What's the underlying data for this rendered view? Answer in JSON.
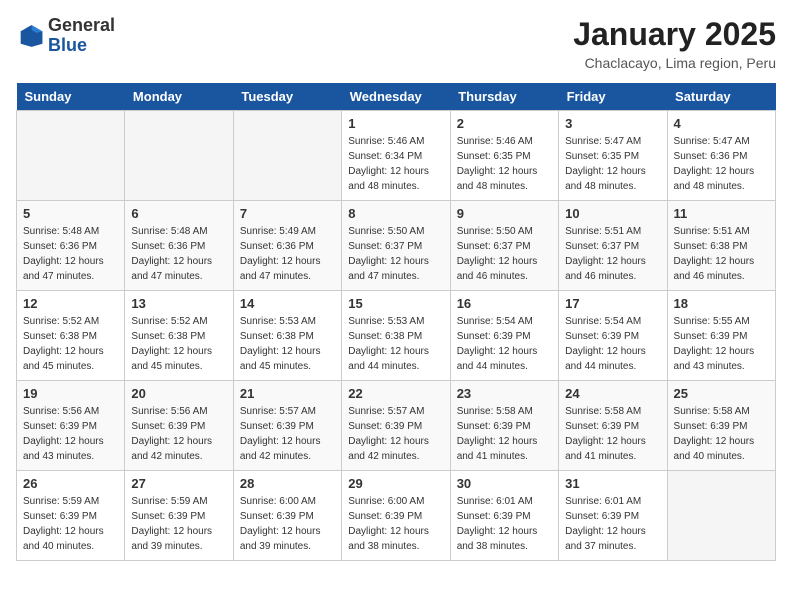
{
  "header": {
    "logo_general": "General",
    "logo_blue": "Blue",
    "title": "January 2025",
    "subtitle": "Chaclacayo, Lima region, Peru"
  },
  "weekdays": [
    "Sunday",
    "Monday",
    "Tuesday",
    "Wednesday",
    "Thursday",
    "Friday",
    "Saturday"
  ],
  "weeks": [
    [
      {
        "day": "",
        "sunrise": "",
        "sunset": "",
        "daylight": ""
      },
      {
        "day": "",
        "sunrise": "",
        "sunset": "",
        "daylight": ""
      },
      {
        "day": "",
        "sunrise": "",
        "sunset": "",
        "daylight": ""
      },
      {
        "day": "1",
        "sunrise": "Sunrise: 5:46 AM",
        "sunset": "Sunset: 6:34 PM",
        "daylight": "Daylight: 12 hours and 48 minutes."
      },
      {
        "day": "2",
        "sunrise": "Sunrise: 5:46 AM",
        "sunset": "Sunset: 6:35 PM",
        "daylight": "Daylight: 12 hours and 48 minutes."
      },
      {
        "day": "3",
        "sunrise": "Sunrise: 5:47 AM",
        "sunset": "Sunset: 6:35 PM",
        "daylight": "Daylight: 12 hours and 48 minutes."
      },
      {
        "day": "4",
        "sunrise": "Sunrise: 5:47 AM",
        "sunset": "Sunset: 6:36 PM",
        "daylight": "Daylight: 12 hours and 48 minutes."
      }
    ],
    [
      {
        "day": "5",
        "sunrise": "Sunrise: 5:48 AM",
        "sunset": "Sunset: 6:36 PM",
        "daylight": "Daylight: 12 hours and 47 minutes."
      },
      {
        "day": "6",
        "sunrise": "Sunrise: 5:48 AM",
        "sunset": "Sunset: 6:36 PM",
        "daylight": "Daylight: 12 hours and 47 minutes."
      },
      {
        "day": "7",
        "sunrise": "Sunrise: 5:49 AM",
        "sunset": "Sunset: 6:36 PM",
        "daylight": "Daylight: 12 hours and 47 minutes."
      },
      {
        "day": "8",
        "sunrise": "Sunrise: 5:50 AM",
        "sunset": "Sunset: 6:37 PM",
        "daylight": "Daylight: 12 hours and 47 minutes."
      },
      {
        "day": "9",
        "sunrise": "Sunrise: 5:50 AM",
        "sunset": "Sunset: 6:37 PM",
        "daylight": "Daylight: 12 hours and 46 minutes."
      },
      {
        "day": "10",
        "sunrise": "Sunrise: 5:51 AM",
        "sunset": "Sunset: 6:37 PM",
        "daylight": "Daylight: 12 hours and 46 minutes."
      },
      {
        "day": "11",
        "sunrise": "Sunrise: 5:51 AM",
        "sunset": "Sunset: 6:38 PM",
        "daylight": "Daylight: 12 hours and 46 minutes."
      }
    ],
    [
      {
        "day": "12",
        "sunrise": "Sunrise: 5:52 AM",
        "sunset": "Sunset: 6:38 PM",
        "daylight": "Daylight: 12 hours and 45 minutes."
      },
      {
        "day": "13",
        "sunrise": "Sunrise: 5:52 AM",
        "sunset": "Sunset: 6:38 PM",
        "daylight": "Daylight: 12 hours and 45 minutes."
      },
      {
        "day": "14",
        "sunrise": "Sunrise: 5:53 AM",
        "sunset": "Sunset: 6:38 PM",
        "daylight": "Daylight: 12 hours and 45 minutes."
      },
      {
        "day": "15",
        "sunrise": "Sunrise: 5:53 AM",
        "sunset": "Sunset: 6:38 PM",
        "daylight": "Daylight: 12 hours and 44 minutes."
      },
      {
        "day": "16",
        "sunrise": "Sunrise: 5:54 AM",
        "sunset": "Sunset: 6:39 PM",
        "daylight": "Daylight: 12 hours and 44 minutes."
      },
      {
        "day": "17",
        "sunrise": "Sunrise: 5:54 AM",
        "sunset": "Sunset: 6:39 PM",
        "daylight": "Daylight: 12 hours and 44 minutes."
      },
      {
        "day": "18",
        "sunrise": "Sunrise: 5:55 AM",
        "sunset": "Sunset: 6:39 PM",
        "daylight": "Daylight: 12 hours and 43 minutes."
      }
    ],
    [
      {
        "day": "19",
        "sunrise": "Sunrise: 5:56 AM",
        "sunset": "Sunset: 6:39 PM",
        "daylight": "Daylight: 12 hours and 43 minutes."
      },
      {
        "day": "20",
        "sunrise": "Sunrise: 5:56 AM",
        "sunset": "Sunset: 6:39 PM",
        "daylight": "Daylight: 12 hours and 42 minutes."
      },
      {
        "day": "21",
        "sunrise": "Sunrise: 5:57 AM",
        "sunset": "Sunset: 6:39 PM",
        "daylight": "Daylight: 12 hours and 42 minutes."
      },
      {
        "day": "22",
        "sunrise": "Sunrise: 5:57 AM",
        "sunset": "Sunset: 6:39 PM",
        "daylight": "Daylight: 12 hours and 42 minutes."
      },
      {
        "day": "23",
        "sunrise": "Sunrise: 5:58 AM",
        "sunset": "Sunset: 6:39 PM",
        "daylight": "Daylight: 12 hours and 41 minutes."
      },
      {
        "day": "24",
        "sunrise": "Sunrise: 5:58 AM",
        "sunset": "Sunset: 6:39 PM",
        "daylight": "Daylight: 12 hours and 41 minutes."
      },
      {
        "day": "25",
        "sunrise": "Sunrise: 5:58 AM",
        "sunset": "Sunset: 6:39 PM",
        "daylight": "Daylight: 12 hours and 40 minutes."
      }
    ],
    [
      {
        "day": "26",
        "sunrise": "Sunrise: 5:59 AM",
        "sunset": "Sunset: 6:39 PM",
        "daylight": "Daylight: 12 hours and 40 minutes."
      },
      {
        "day": "27",
        "sunrise": "Sunrise: 5:59 AM",
        "sunset": "Sunset: 6:39 PM",
        "daylight": "Daylight: 12 hours and 39 minutes."
      },
      {
        "day": "28",
        "sunrise": "Sunrise: 6:00 AM",
        "sunset": "Sunset: 6:39 PM",
        "daylight": "Daylight: 12 hours and 39 minutes."
      },
      {
        "day": "29",
        "sunrise": "Sunrise: 6:00 AM",
        "sunset": "Sunset: 6:39 PM",
        "daylight": "Daylight: 12 hours and 38 minutes."
      },
      {
        "day": "30",
        "sunrise": "Sunrise: 6:01 AM",
        "sunset": "Sunset: 6:39 PM",
        "daylight": "Daylight: 12 hours and 38 minutes."
      },
      {
        "day": "31",
        "sunrise": "Sunrise: 6:01 AM",
        "sunset": "Sunset: 6:39 PM",
        "daylight": "Daylight: 12 hours and 37 minutes."
      },
      {
        "day": "",
        "sunrise": "",
        "sunset": "",
        "daylight": ""
      }
    ]
  ]
}
